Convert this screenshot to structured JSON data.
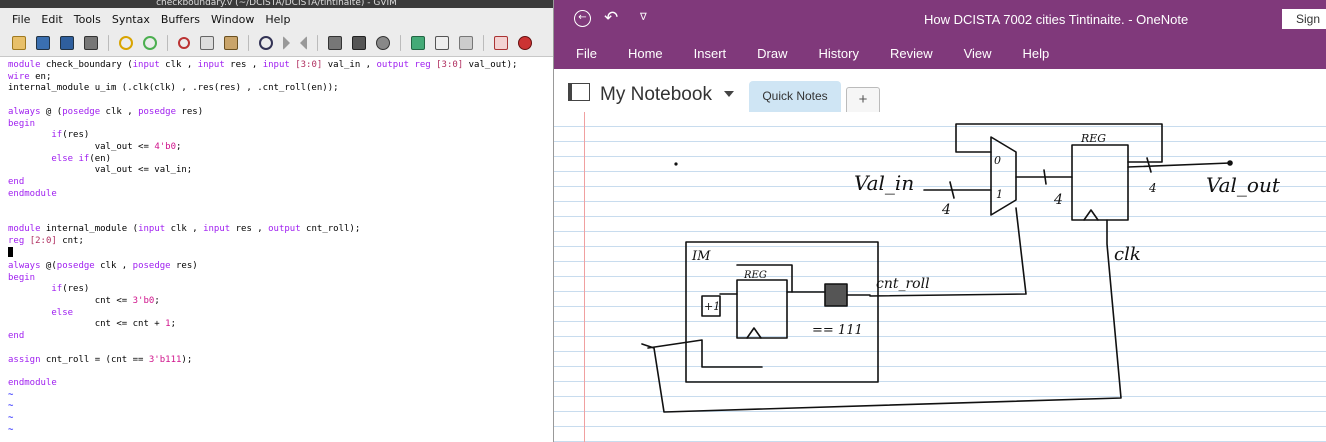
{
  "vim": {
    "title": "checkboundary.v (~/DCISTA/DCISTA/tintinaite) - GVIM",
    "menu": [
      "File",
      "Edit",
      "Tools",
      "Syntax",
      "Buffers",
      "Window",
      "Help"
    ],
    "toolbar_icons": [
      "open-icon",
      "save-icon",
      "save-all-icon",
      "print-icon",
      "undo-icon",
      "redo-icon",
      "cut-icon",
      "copy-icon",
      "paste-icon",
      "find-replace-icon",
      "find-next-icon",
      "find-prev-icon",
      "load-session-icon",
      "save-session-icon",
      "run-script-icon",
      "make-icon",
      "ctags-icon",
      "jump-tag-icon",
      "help-icon",
      "find-help-icon"
    ]
  },
  "onenote": {
    "title": "How DCISTA 7002 cities Tintinaite.  -  OneNote",
    "sign_in": "Sign",
    "ribbon": [
      "File",
      "Home",
      "Insert",
      "Draw",
      "History",
      "Review",
      "View",
      "Help"
    ],
    "notebook": "My Notebook",
    "section_tab": "Quick Notes",
    "add_tab": "+",
    "ink_labels": {
      "val_in": "Val_in",
      "val_out": "Val_out",
      "clk": "clk",
      "cnt_roll": "cnt_roll",
      "reg_top": "REG",
      "reg_inner": "REG",
      "im": "IM",
      "mux_0": "0",
      "mux_1": "1",
      "bus_4_a": "4",
      "bus_4_b": "4",
      "bus_4_c": "4",
      "plus1": "+1",
      "eq111": "== 111"
    }
  },
  "accent_color": "#80397b"
}
